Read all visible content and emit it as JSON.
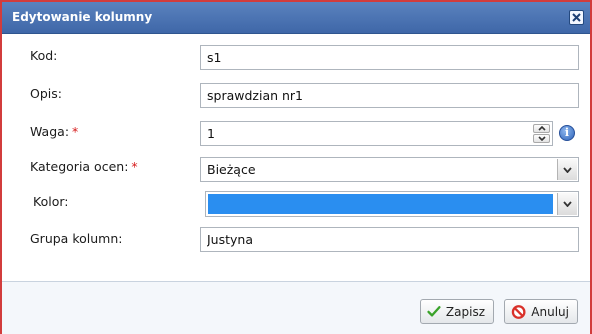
{
  "dialog": {
    "title": "Edytowanie kolumny",
    "close_icon": "close-icon",
    "border_color": "#d23c3c",
    "title_bg": "#4a73b3"
  },
  "form": {
    "kod": {
      "label": "Kod:",
      "value": "s1"
    },
    "opis": {
      "label": "Opis:",
      "value": "sprawdzian nr1"
    },
    "waga": {
      "label": "Waga:",
      "required_mark": "*",
      "value": "1",
      "info_icon": "info-icon",
      "info_glyph": "i"
    },
    "kategoria": {
      "label": "Kategoria ocen:",
      "required_mark": "*",
      "selected": "Bieżące"
    },
    "kolor": {
      "label": "Kolor:",
      "selected_color": "#2a8ef0"
    },
    "grupa": {
      "label": "Grupa kolumn:",
      "value": "Justyna"
    }
  },
  "buttons": {
    "save": {
      "label": "Zapisz",
      "icon": "checkmark-icon"
    },
    "cancel": {
      "label": "Anuluj",
      "icon": "cancel-icon"
    }
  }
}
